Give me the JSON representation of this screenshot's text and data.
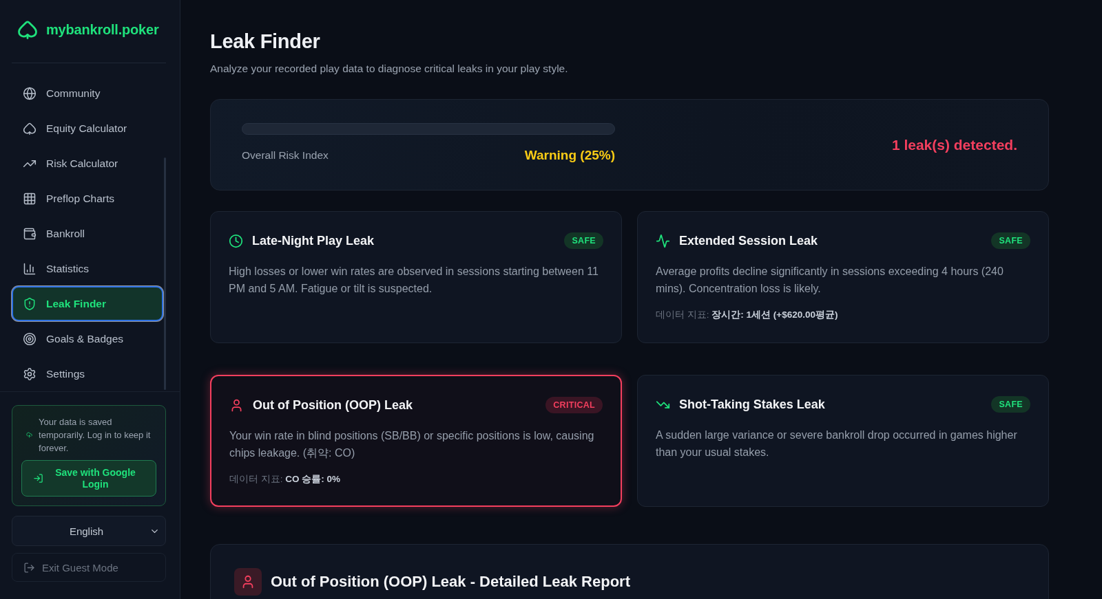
{
  "sidebar": {
    "logo": "mybankroll.poker",
    "nav": [
      {
        "label": "Community",
        "selected": false
      },
      {
        "label": "Equity Calculator",
        "selected": false
      },
      {
        "label": "Risk Calculator",
        "selected": false
      },
      {
        "label": "Preflop Charts",
        "selected": false
      },
      {
        "label": "Bankroll",
        "selected": false
      },
      {
        "label": "Statistics",
        "selected": false
      },
      {
        "label": "Leak Finder",
        "selected": true
      },
      {
        "label": "Goals & Badges",
        "selected": false
      },
      {
        "label": "Settings",
        "selected": false
      }
    ],
    "guest_notice": {
      "text": "Your data is saved temporarily. Log in to keep it forever.",
      "button": "Save with Google Login"
    },
    "language": {
      "value": "English"
    },
    "exit_button": "Exit Guest Mode"
  },
  "header": {
    "title": "Leak Finder",
    "subtitle": "Analyze your recorded play data to diagnose critical leaks in your play style."
  },
  "risk": {
    "label": "Overall Risk Index",
    "status": "Warning (25%)",
    "summary": "1 leak(s) detected."
  },
  "leaks": [
    {
      "title": "Late-Night Play Leak",
      "critical": false,
      "badge": "SAFE",
      "description": "High losses or lower win rates are observed in sessions starting between 11 PM and 5 AM. Fatigue or tilt is suspected."
    },
    {
      "title": "Extended Session Leak",
      "critical": false,
      "badge": "SAFE",
      "description": "Average profits decline significantly in sessions exceeding 4 hours (240 mins). Concentration loss is likely.",
      "metric": "데이터 지표: **장시간: 1세션 (+$620.00평균)**"
    },
    {
      "title": "Out of Position (OOP) Leak",
      "critical": true,
      "badge": "CRITICAL",
      "description": "Your win rate in blind positions (SB/BB) or specific positions is low, causing chips leakage. (취약: CO)",
      "metric": "데이터 지표: **CO 승률: 0%**"
    },
    {
      "title": "Shot-Taking Stakes Leak",
      "critical": false,
      "badge": "SAFE",
      "description": "A sudden large variance or severe bankroll drop occurred in games higher than your usual stakes."
    }
  ],
  "report": {
    "title": "Out of Position (OOP) Leak - Detailed Leak Report"
  }
}
